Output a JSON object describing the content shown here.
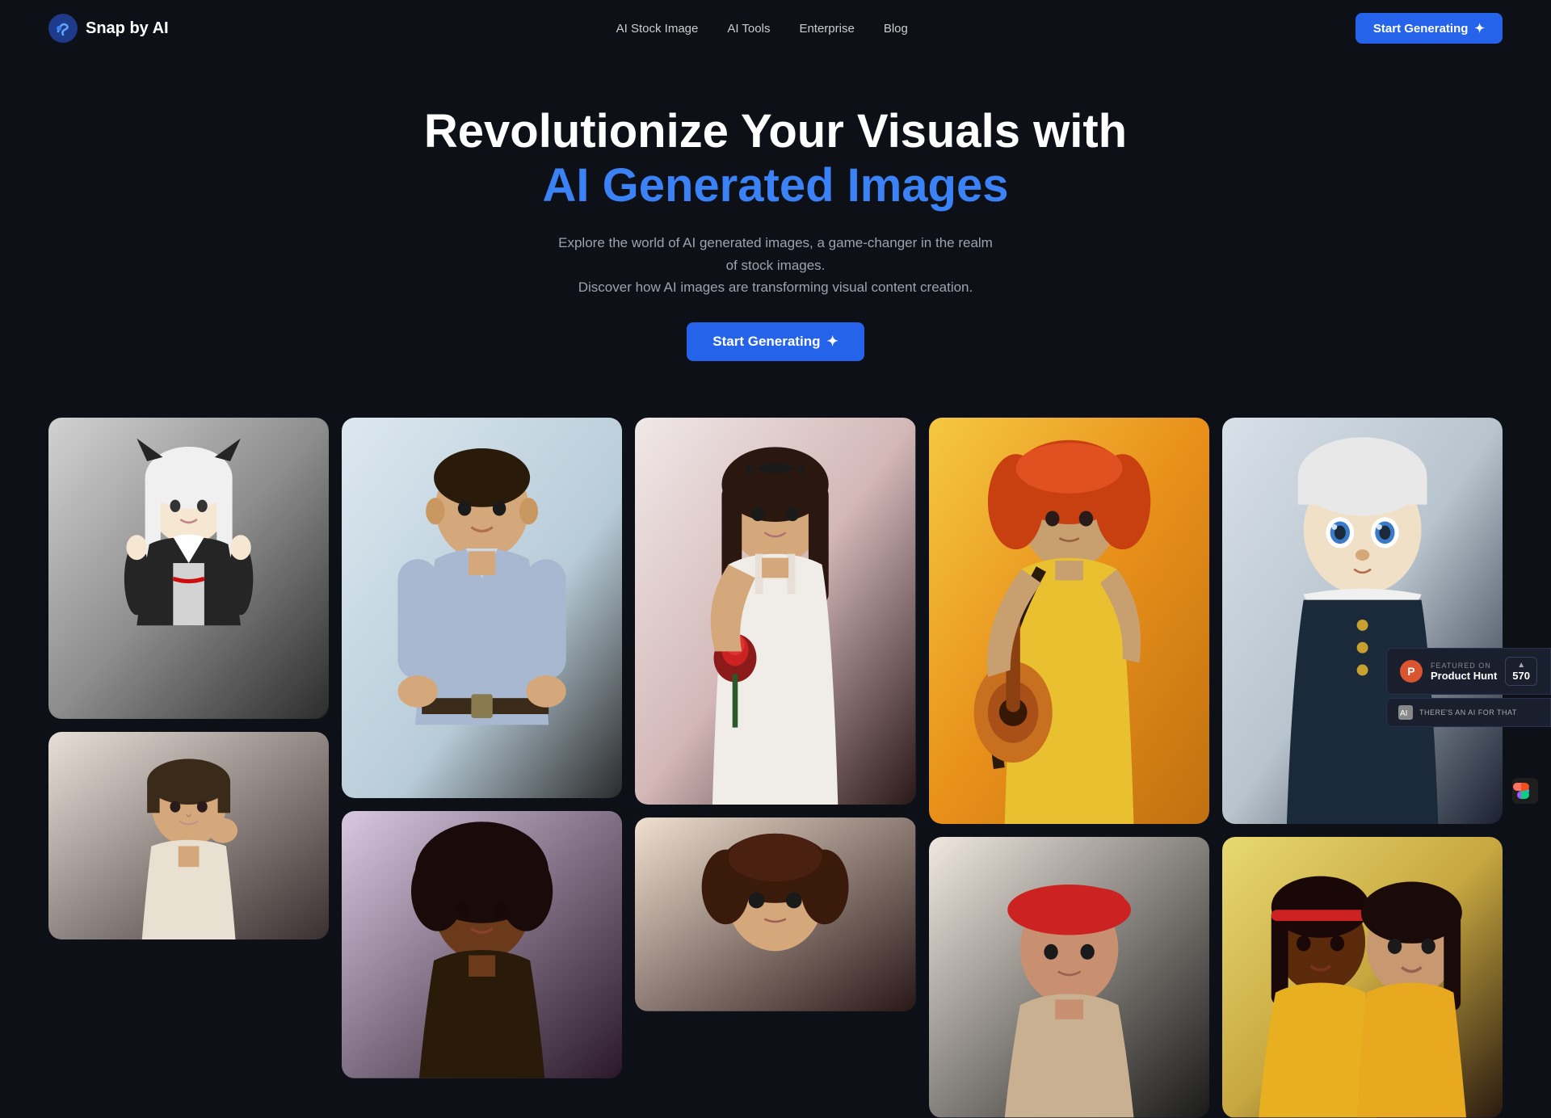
{
  "brand": {
    "name": "Snap by AI",
    "logo_alt": "Snap by AI logo"
  },
  "nav": {
    "links": [
      {
        "label": "AI Stock Image",
        "id": "nav-stock"
      },
      {
        "label": "AI Tools",
        "id": "nav-tools"
      },
      {
        "label": "Enterprise",
        "id": "nav-enterprise"
      },
      {
        "label": "Blog",
        "id": "nav-blog"
      }
    ],
    "cta_label": "Start Generating",
    "cta_icon": "✦"
  },
  "hero": {
    "title_line1": "Revolutionize Your Visuals with",
    "title_line2": "AI Generated Images",
    "subtitle_line1": "Explore the world of AI generated images, a game-changer in the realm of stock images.",
    "subtitle_line2": "Discover how AI images are transforming visual content creation.",
    "cta_label": "Start Generating",
    "cta_icon": "✦"
  },
  "product_hunt": {
    "featured_label": "FEATURED ON",
    "name": "Product Hunt",
    "vote_count": "570",
    "vote_arrow": "▲"
  },
  "there_ai": {
    "label": "THERE'S AN AI FOR THAT"
  },
  "colors": {
    "bg": "#0d1117",
    "accent": "#2563eb",
    "blue_text": "#3b82f6",
    "ph_orange": "#da552f"
  }
}
